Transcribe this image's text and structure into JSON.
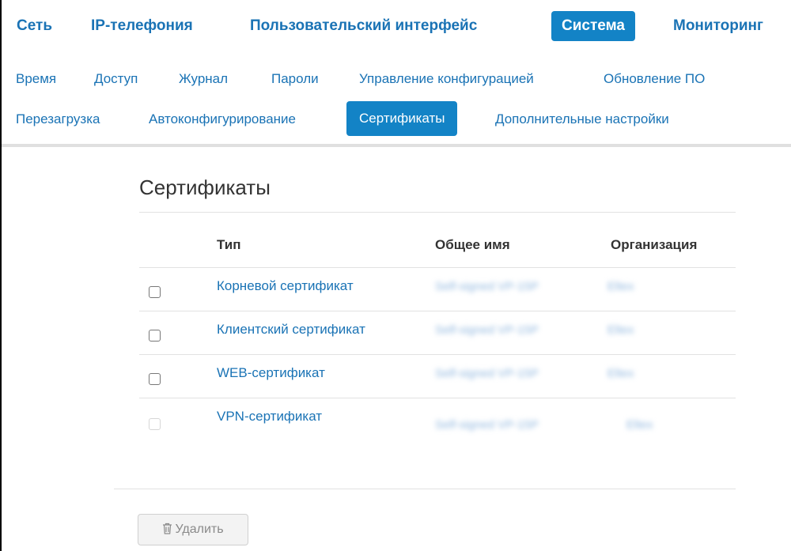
{
  "topnav": {
    "items": [
      {
        "label": "Сеть"
      },
      {
        "label": "IP-телефония"
      },
      {
        "label": "Пользовательский интерфейс"
      },
      {
        "label": "Система",
        "active": true
      },
      {
        "label": "Мониторинг"
      }
    ]
  },
  "subnav": {
    "items": [
      {
        "label": "Время"
      },
      {
        "label": "Доступ"
      },
      {
        "label": "Журнал"
      },
      {
        "label": "Пароли"
      },
      {
        "label": "Управление конфигурацией"
      },
      {
        "label": "Обновление ПО"
      },
      {
        "label": "Перезагрузка"
      },
      {
        "label": "Автоконфигурирование"
      },
      {
        "label": "Сертификаты",
        "active": true
      },
      {
        "label": "Дополнительные настройки"
      }
    ]
  },
  "panel": {
    "title": "Сертификаты",
    "columns": [
      "Тип",
      "Общее имя",
      "Организация"
    ],
    "rows": [
      {
        "type": "Корневой сертификат",
        "common_name": "Self-signed VP-15P",
        "organization": "Eltex",
        "checkbox_enabled": true
      },
      {
        "type": "Клиентский сертификат",
        "common_name": "Self-signed VP-15P",
        "organization": "Eltex",
        "checkbox_enabled": true
      },
      {
        "type": "WEB-сертификат",
        "common_name": "Self-signed VP-15P",
        "organization": "Eltex",
        "checkbox_enabled": true
      },
      {
        "type": "VPN-сертификат",
        "common_name": "Self-signed VP-15P",
        "organization": "Eltex",
        "checkbox_enabled": false
      }
    ],
    "delete_label": "Удалить",
    "delete_icon": "trash-icon"
  },
  "colors": {
    "accent": "#1383c6",
    "link": "#1a73b5"
  }
}
